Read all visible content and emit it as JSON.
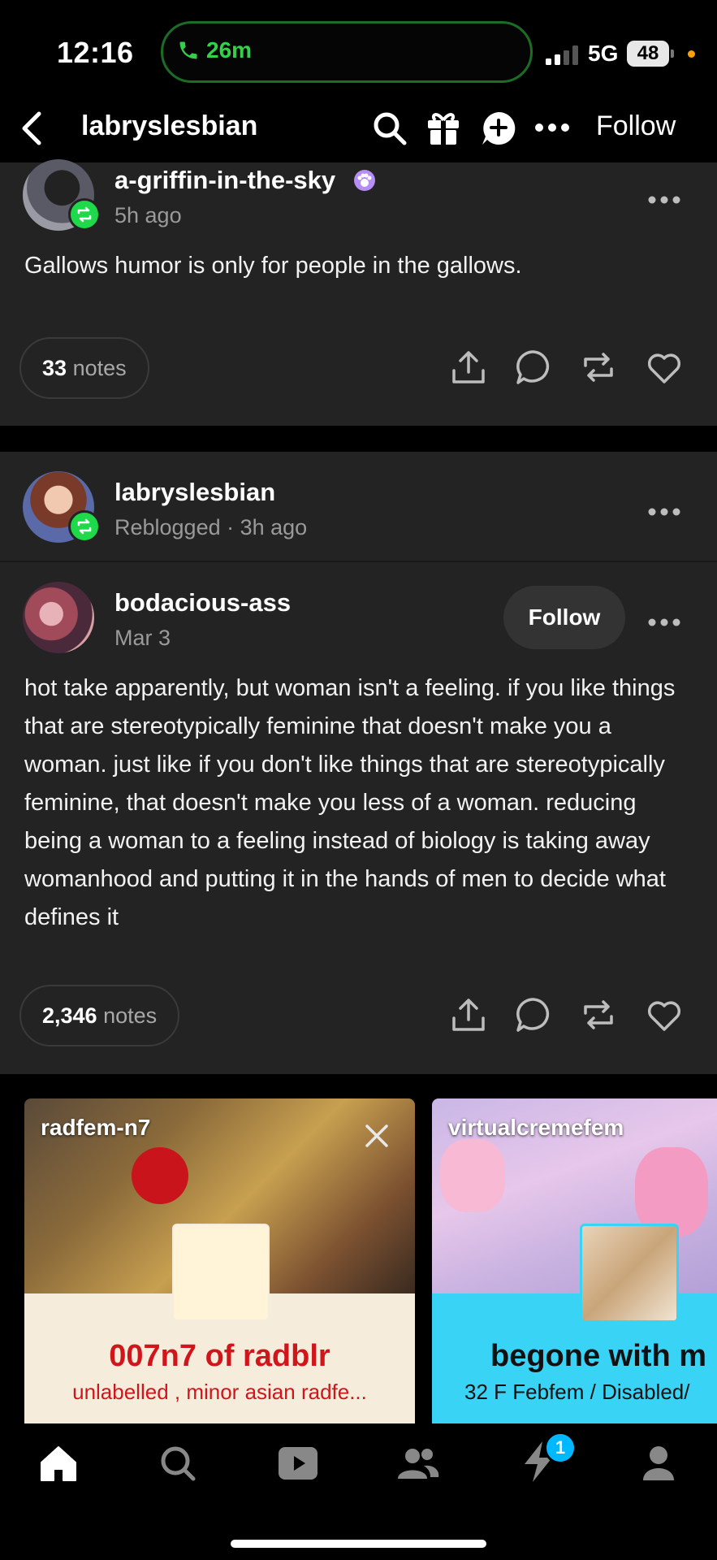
{
  "status_bar": {
    "time": "12:16",
    "call_duration": "26m",
    "network": "5G",
    "battery": "48"
  },
  "header": {
    "title": "labryslesbian",
    "follow_label": "Follow"
  },
  "post1": {
    "username": "a-griffin-in-the-sky",
    "time": "5h ago",
    "body": "Gallows humor is only for people in the gallows.",
    "notes_count": "33",
    "notes_label": "notes"
  },
  "post2": {
    "reblogger": "labryslesbian",
    "reblog_meta": "Reblogged · 3h ago",
    "author": "bodacious-ass",
    "author_date": "Mar 3",
    "follow_label": "Follow",
    "body": "hot take apparently, but woman isn't a feeling. if you like things that are stereotypically feminine that doesn't make you a woman.  just like if you don't like things that are stereotypically feminine, that doesn't make you less of a woman. reducing being a woman to a feeling instead of biology is taking away womanhood and putting it in the hands of men to decide what defines it",
    "notes_count": "2,346",
    "notes_label": "notes"
  },
  "suggestions": [
    {
      "name": "radfem-n7",
      "title": "007n7 of radblr",
      "subtitle": "unlabelled , minor asian radfe...",
      "color": "#f5ecdc",
      "title_color": "#d0161b"
    },
    {
      "name": "virtualcremefem",
      "title": "begone with m",
      "subtitle": "32 F Febfem / Disabled/",
      "color": "#38d3f5",
      "title_color": "#111111"
    }
  ],
  "bottom_nav": {
    "activity_badge": "1"
  },
  "icons": [
    "back-icon",
    "search-icon",
    "gift-icon",
    "chat-plus-icon",
    "more-icon",
    "share-icon",
    "reply-icon",
    "reblog-icon",
    "like-icon",
    "close-icon",
    "home-icon",
    "explore-icon",
    "video-icon",
    "community-icon",
    "activity-icon",
    "account-icon"
  ]
}
